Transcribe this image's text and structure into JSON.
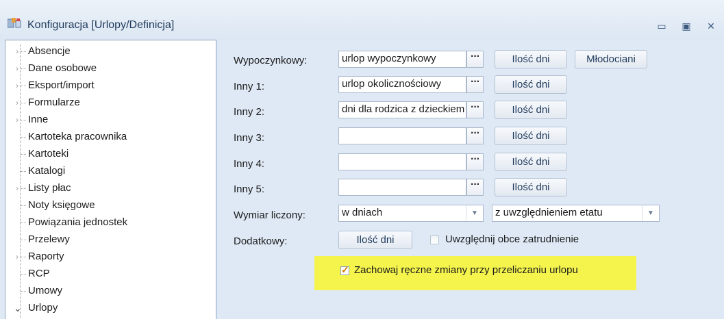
{
  "window": {
    "title": "Konfiguracja [Urlopy/Definicja]",
    "minimize_glyph": "▭",
    "maximize_glyph": "▣",
    "close_glyph": "✕",
    "icon": "config-app-icon"
  },
  "tree": {
    "items": [
      {
        "label": "Absencje",
        "expander": "›"
      },
      {
        "label": "Dane osobowe",
        "expander": "›"
      },
      {
        "label": "Eksport/import",
        "expander": "›"
      },
      {
        "label": "Formularze",
        "expander": "›"
      },
      {
        "label": "Inne",
        "expander": "›"
      },
      {
        "label": "Kartoteka pracownika",
        "expander": ""
      },
      {
        "label": "Kartoteki",
        "expander": ""
      },
      {
        "label": "Katalogi",
        "expander": ""
      },
      {
        "label": "Listy płac",
        "expander": "›"
      },
      {
        "label": "Noty księgowe",
        "expander": ""
      },
      {
        "label": "Powiązania jednostek",
        "expander": ""
      },
      {
        "label": "Przelewy",
        "expander": ""
      },
      {
        "label": "Raporty",
        "expander": "›"
      },
      {
        "label": "RCP",
        "expander": ""
      },
      {
        "label": "Umowy",
        "expander": ""
      },
      {
        "label": "Urlopy",
        "expander": "⌄"
      }
    ]
  },
  "form": {
    "rows": [
      {
        "label": "Wypoczynkowy:",
        "value": "urlop wypoczynkowy",
        "dots": "···",
        "days_button": "Ilość dni",
        "extra_button": "Młodociani"
      },
      {
        "label": "Inny 1:",
        "value": "urlop okolicznościowy",
        "dots": "···",
        "days_button": "Ilość dni"
      },
      {
        "label": "Inny 2:",
        "value": "dni dla rodzica z dzieckiem",
        "dots": "···",
        "days_button": "Ilość dni"
      },
      {
        "label": "Inny 3:",
        "value": "",
        "dots": "···",
        "days_button": "Ilość dni"
      },
      {
        "label": "Inny 4:",
        "value": "",
        "dots": "···",
        "days_button": "Ilość dni"
      },
      {
        "label": "Inny 5:",
        "value": "",
        "dots": "···",
        "days_button": "Ilość dni"
      }
    ],
    "measure": {
      "label": "Wymiar liczony:",
      "unit_value": "w dniach",
      "etat_value": "z uwzględnieniem etatu",
      "arrow": "▼"
    },
    "additional": {
      "label": "Dodatkowy:",
      "days_button": "Ilość dni",
      "foreign_employment_label": "Uwzględnij obce zatrudnienie",
      "foreign_employment_checked": false
    },
    "keep_changes": {
      "label": "Zachowaj ręczne zmiany przy przeliczaniu urlopu",
      "checked": true,
      "checkmark": "✓"
    }
  },
  "colors": {
    "highlight": "#f4f44d",
    "window_bg": "#dfe9f5",
    "title_text": "#1e395b"
  }
}
